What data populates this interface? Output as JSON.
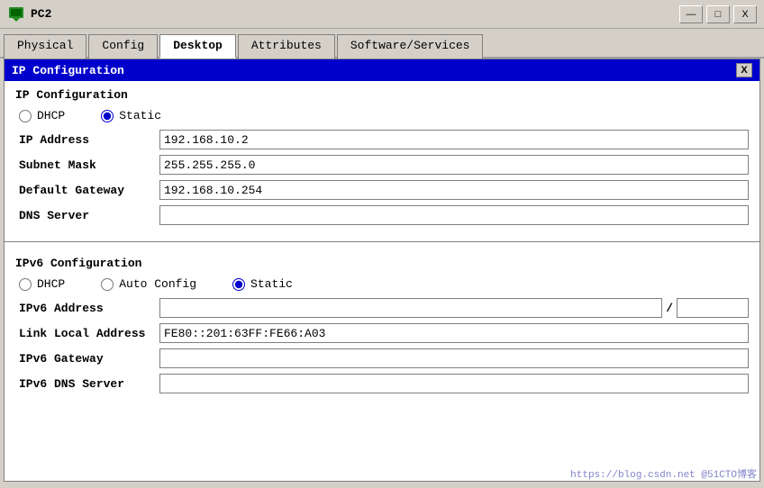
{
  "window": {
    "title": "PC2",
    "minimize_label": "—",
    "maximize_label": "□",
    "close_label": "X"
  },
  "tabs": [
    {
      "label": "Physical",
      "active": false
    },
    {
      "label": "Config",
      "active": false
    },
    {
      "label": "Desktop",
      "active": true
    },
    {
      "label": "Attributes",
      "active": false
    },
    {
      "label": "Software/Services",
      "active": false
    }
  ],
  "config_panel": {
    "header": "IP Configuration",
    "close_btn": "X"
  },
  "ipv4": {
    "section_title": "IP Configuration",
    "dhcp_label": "DHCP",
    "static_label": "Static",
    "ip_address_label": "IP Address",
    "ip_address_value": "192.168.10.2",
    "subnet_mask_label": "Subnet Mask",
    "subnet_mask_value": "255.255.255.0",
    "default_gateway_label": "Default Gateway",
    "default_gateway_value": "192.168.10.254",
    "dns_server_label": "DNS Server",
    "dns_server_value": ""
  },
  "ipv6": {
    "section_title": "IPv6 Configuration",
    "dhcp_label": "DHCP",
    "auto_config_label": "Auto Config",
    "static_label": "Static",
    "ipv6_address_label": "IPv6 Address",
    "ipv6_address_value": "",
    "ipv6_prefix_value": "",
    "link_local_label": "Link Local Address",
    "link_local_value": "FE80::201:63FF:FE66:A03",
    "gateway_label": "IPv6 Gateway",
    "gateway_value": "",
    "dns_label": "IPv6 DNS Server",
    "dns_value": ""
  },
  "watermark": "https://blog.csdn.net @51CTO博客"
}
